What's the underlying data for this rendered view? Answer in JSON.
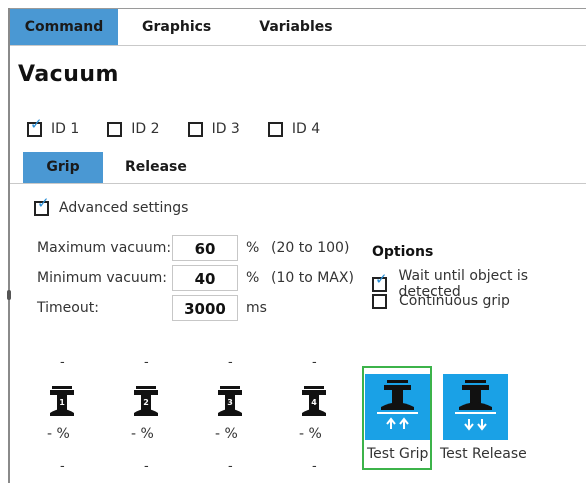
{
  "tabs": [
    {
      "label": "Command",
      "active": true
    },
    {
      "label": "Graphics",
      "active": false
    },
    {
      "label": "Variables",
      "active": false
    }
  ],
  "title": "Vacuum",
  "ids": [
    {
      "label": "ID 1",
      "checked": true
    },
    {
      "label": "ID 2",
      "checked": false
    },
    {
      "label": "ID 3",
      "checked": false
    },
    {
      "label": "ID 4",
      "checked": false
    }
  ],
  "subtabs": [
    {
      "label": "Grip",
      "active": true
    },
    {
      "label": "Release",
      "active": false
    }
  ],
  "advanced": {
    "label": "Advanced settings",
    "checked": true
  },
  "params": {
    "max": {
      "label": "Maximum vacuum:",
      "value": "60",
      "unit": "%",
      "range": "(20 to 100)"
    },
    "min": {
      "label": "Minimum vacuum:",
      "value": "40",
      "unit": "%",
      "range": "(10 to MAX)"
    },
    "timeout": {
      "label": "Timeout:",
      "value": "3000",
      "unit": "ms"
    }
  },
  "options": {
    "title": "Options",
    "wait": {
      "label": "Wait until object is detected",
      "checked": true
    },
    "continuous": {
      "label": "Continuous grip",
      "checked": false
    }
  },
  "cups": [
    {
      "id": "1",
      "top": "-",
      "percent": "- %",
      "bottom": "-"
    },
    {
      "id": "2",
      "top": "-",
      "percent": "- %",
      "bottom": "-"
    },
    {
      "id": "3",
      "top": "-",
      "percent": "- %",
      "bottom": "-"
    },
    {
      "id": "4",
      "top": "-",
      "percent": "- %",
      "bottom": "-"
    }
  ],
  "buttons": {
    "test_grip": "Test Grip",
    "test_release": "Test Release"
  },
  "colors": {
    "accent": "#4a98d3",
    "button": "#1aa1e6",
    "focus": "#3cb34a"
  }
}
